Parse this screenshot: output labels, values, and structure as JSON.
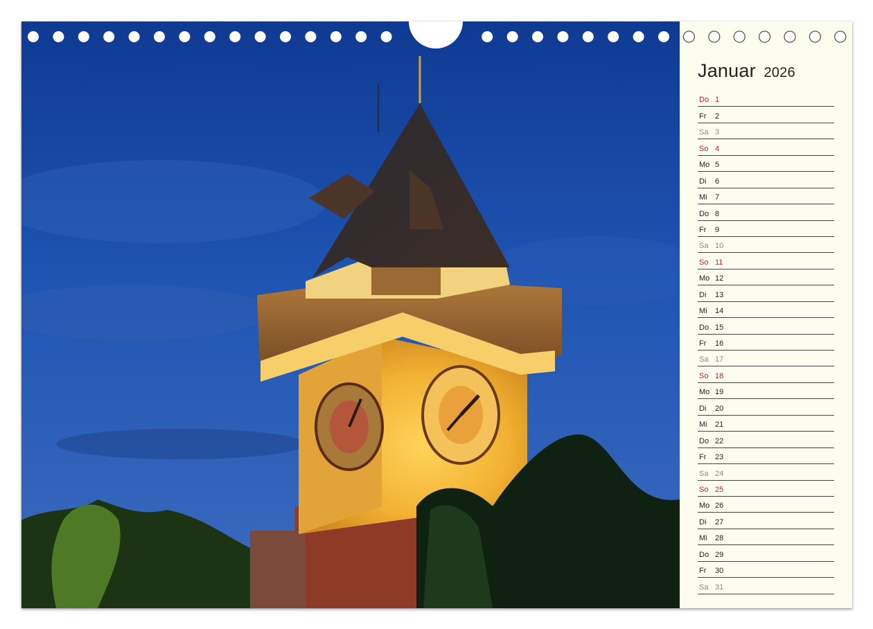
{
  "calendar": {
    "month": "Januar",
    "year": "2026",
    "days": [
      {
        "wd": "Do",
        "d": "1",
        "type": "holiday"
      },
      {
        "wd": "Fr",
        "d": "2",
        "type": "weekday"
      },
      {
        "wd": "Sa",
        "d": "3",
        "type": "sat"
      },
      {
        "wd": "So",
        "d": "4",
        "type": "sun"
      },
      {
        "wd": "Mo",
        "d": "5",
        "type": "weekday"
      },
      {
        "wd": "Di",
        "d": "6",
        "type": "weekday"
      },
      {
        "wd": "Mi",
        "d": "7",
        "type": "weekday"
      },
      {
        "wd": "Do",
        "d": "8",
        "type": "weekday"
      },
      {
        "wd": "Fr",
        "d": "9",
        "type": "weekday"
      },
      {
        "wd": "Sa",
        "d": "10",
        "type": "sat"
      },
      {
        "wd": "So",
        "d": "11",
        "type": "sun"
      },
      {
        "wd": "Mo",
        "d": "12",
        "type": "weekday"
      },
      {
        "wd": "Di",
        "d": "13",
        "type": "weekday"
      },
      {
        "wd": "Mi",
        "d": "14",
        "type": "weekday"
      },
      {
        "wd": "Do",
        "d": "15",
        "type": "weekday"
      },
      {
        "wd": "Fr",
        "d": "16",
        "type": "weekday"
      },
      {
        "wd": "Sa",
        "d": "17",
        "type": "sat"
      },
      {
        "wd": "So",
        "d": "18",
        "type": "sun"
      },
      {
        "wd": "Mo",
        "d": "19",
        "type": "weekday"
      },
      {
        "wd": "Di",
        "d": "20",
        "type": "weekday"
      },
      {
        "wd": "Mi",
        "d": "21",
        "type": "weekday"
      },
      {
        "wd": "Do",
        "d": "22",
        "type": "weekday"
      },
      {
        "wd": "Fr",
        "d": "23",
        "type": "weekday"
      },
      {
        "wd": "Sa",
        "d": "24",
        "type": "sat"
      },
      {
        "wd": "So",
        "d": "25",
        "type": "sun"
      },
      {
        "wd": "Mo",
        "d": "26",
        "type": "weekday"
      },
      {
        "wd": "Di",
        "d": "27",
        "type": "weekday"
      },
      {
        "wd": "Mi",
        "d": "28",
        "type": "weekday"
      },
      {
        "wd": "Do",
        "d": "29",
        "type": "weekday"
      },
      {
        "wd": "Fr",
        "d": "30",
        "type": "weekday"
      },
      {
        "wd": "Sa",
        "d": "31",
        "type": "sat"
      }
    ]
  },
  "colors": {
    "sunday": "#c8202a",
    "saturday": "#8a8a8a",
    "panel_bg": "#fcfcef",
    "sky": "#1d4fa8"
  },
  "photo": {
    "subject": "clock-tower"
  }
}
